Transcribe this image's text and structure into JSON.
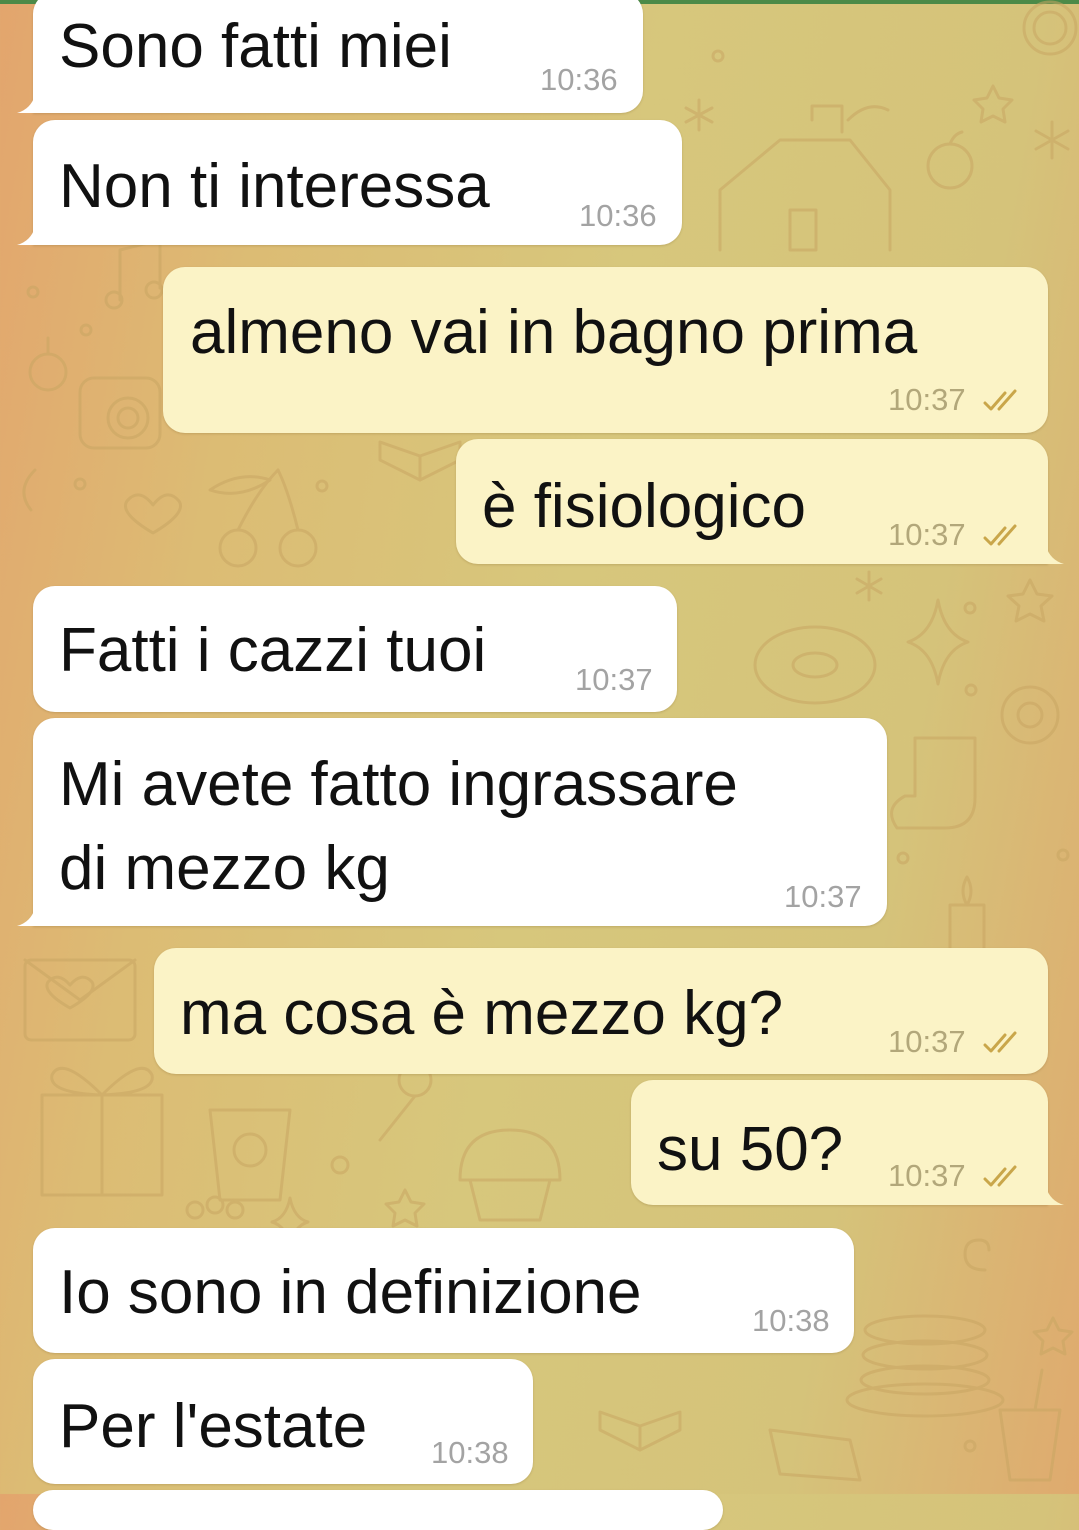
{
  "messages": [
    {
      "id": "m1",
      "direction": "incoming",
      "lines": [
        "Sono fatti miei"
      ],
      "time": "10:36"
    },
    {
      "id": "m2",
      "direction": "incoming",
      "lines": [
        "Non ti interessa"
      ],
      "time": "10:36"
    },
    {
      "id": "m3",
      "direction": "outgoing",
      "lines": [
        "almeno vai in bagno prima"
      ],
      "time": "10:37",
      "status": "read-double-check-icon"
    },
    {
      "id": "m4",
      "direction": "outgoing",
      "lines": [
        "è fisiologico"
      ],
      "time": "10:37",
      "status": "read-double-check-icon"
    },
    {
      "id": "m5",
      "direction": "incoming",
      "lines": [
        "Fatti i cazzi tuoi"
      ],
      "time": "10:37"
    },
    {
      "id": "m6",
      "direction": "incoming",
      "lines": [
        "Mi avete fatto ingrassare",
        "di mezzo kg"
      ],
      "time": "10:37"
    },
    {
      "id": "m7",
      "direction": "outgoing",
      "lines": [
        "ma cosa è mezzo kg?"
      ],
      "time": "10:37",
      "status": "read-double-check-icon"
    },
    {
      "id": "m8",
      "direction": "outgoing",
      "lines": [
        "su 50?"
      ],
      "time": "10:37",
      "status": "read-double-check-icon"
    },
    {
      "id": "m9",
      "direction": "incoming",
      "lines": [
        "Io sono in definizione"
      ],
      "time": "10:38"
    },
    {
      "id": "m10",
      "direction": "incoming",
      "lines": [
        "Per l'estate"
      ],
      "time": "10:38"
    }
  ],
  "colors": {
    "incoming_bubble": "#ffffff",
    "outgoing_bubble": "#fbf3c6",
    "check_marks": "#c9a64a",
    "header_accent": "#4c8a48"
  }
}
